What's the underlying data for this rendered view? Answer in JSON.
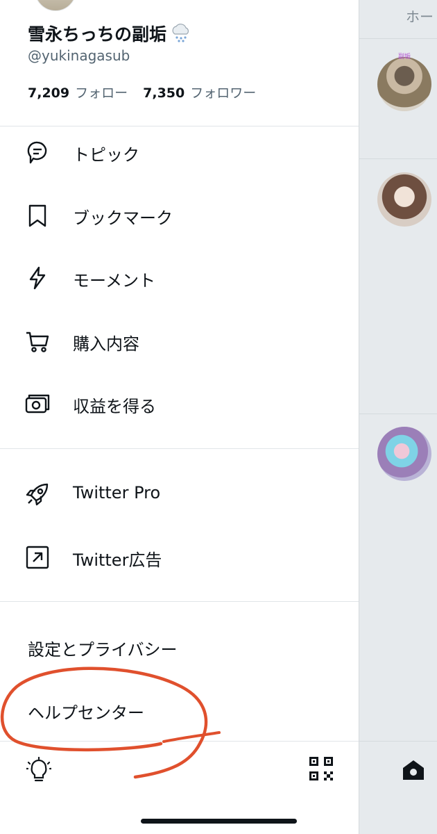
{
  "profile": {
    "display_name": "雪永ちっちの副垢",
    "handle": "@yukinagasub",
    "following_count": "7,209",
    "following_label": "フォロー",
    "followers_count": "7,350",
    "followers_label": "フォロワー",
    "name_emoji": "cloud-with-snow"
  },
  "menu": {
    "items": [
      {
        "label": "トピック",
        "icon": "topics-icon"
      },
      {
        "label": "ブックマーク",
        "icon": "bookmark-icon"
      },
      {
        "label": "モーメント",
        "icon": "lightning-icon"
      },
      {
        "label": "購入内容",
        "icon": "cart-icon"
      },
      {
        "label": "収益を得る",
        "icon": "money-icon"
      }
    ],
    "pro_items": [
      {
        "label": "Twitter Pro",
        "icon": "rocket-icon"
      },
      {
        "label": "Twitter広告",
        "icon": "external-arrow-icon"
      }
    ],
    "settings_label": "設定とプライバシー",
    "help_label": "ヘルプセンター"
  },
  "timeline": {
    "header_title": "ホー",
    "avatar_tag": "副垢"
  },
  "bottom": {
    "left_icon": "lightbulb-icon",
    "right_icon": "qr-code-icon",
    "home_icon": "home-icon"
  },
  "colors": {
    "text": "#0f1419",
    "secondary": "#536471",
    "annotation": "#e0502d",
    "overlay": "#e6eaed"
  }
}
